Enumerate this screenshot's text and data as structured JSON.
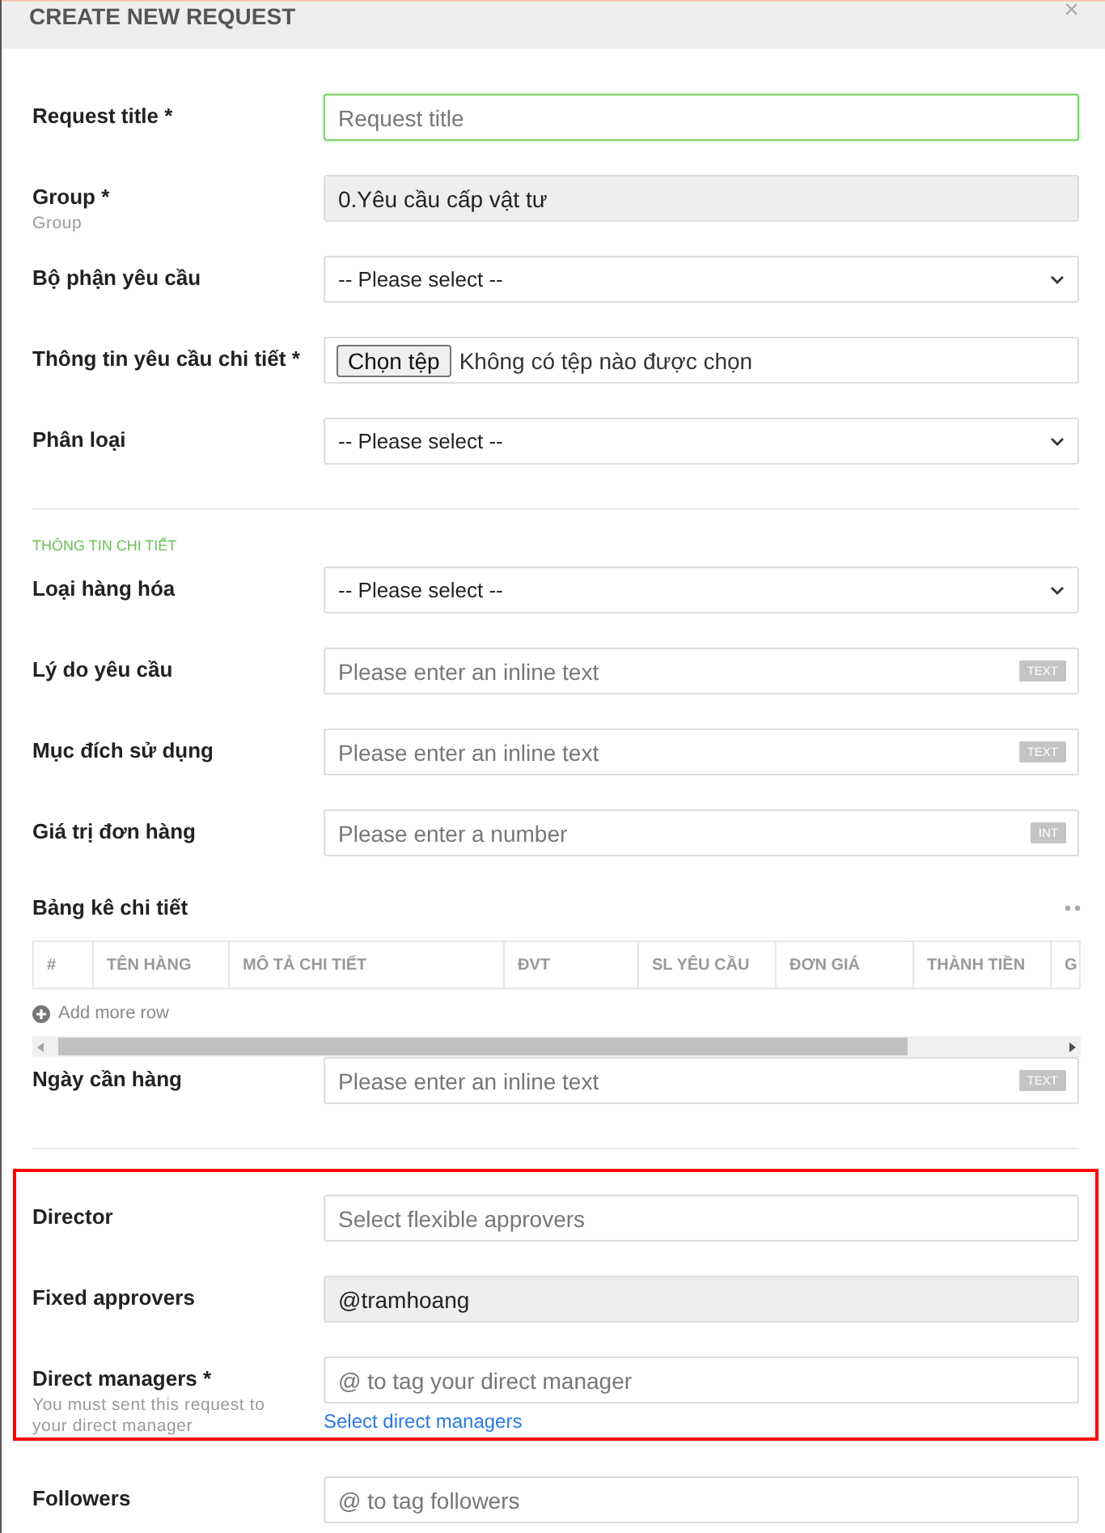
{
  "dialog": {
    "title": "CREATE NEW REQUEST",
    "close": "×"
  },
  "fields": [
    {
      "kind": "input",
      "label": "Request title *",
      "placeholder": "Request title",
      "focused": true
    },
    {
      "kind": "readonly",
      "label": "Group *",
      "hint": "Group",
      "value": "0.Yêu cầu cấp vật tư"
    },
    {
      "kind": "select",
      "label": "Bộ phận yêu cầu",
      "value": "-- Please select --"
    },
    {
      "kind": "file",
      "label": "Thông tin yêu cầu chi tiết *",
      "button": "Chọn tệp",
      "value": "Không có tệp nào được chọn"
    },
    {
      "kind": "select",
      "label": "Phân loại",
      "value": "-- Please select --"
    },
    {
      "kind": "divider"
    },
    {
      "kind": "section",
      "label": "THÔNG TIN CHI TIẾT"
    },
    {
      "kind": "select",
      "label": "Loại hàng hóa",
      "value": "-- Please select --"
    },
    {
      "kind": "input",
      "label": "Lý do yêu cầu",
      "placeholder": "Please enter an inline text",
      "badge": "TEXT",
      "focused": false
    },
    {
      "kind": "input",
      "label": "Mục đích sử dụng",
      "placeholder": "Please enter an inline text",
      "badge": "TEXT",
      "focused": false
    },
    {
      "kind": "input",
      "label": "Giá trị đơn hàng",
      "placeholder": "Please enter a number",
      "badge": "INT",
      "focused": false
    },
    {
      "kind": "table",
      "label": "Bảng kê chi tiết",
      "columns": [
        "#",
        "TÊN HÀNG",
        "MÔ TẢ CHI TIẾT",
        "ĐVT",
        "SL YÊU CẦU",
        "ĐƠN GIÁ",
        "THÀNH TIỀN",
        "G"
      ],
      "add_row": "Add more row"
    },
    {
      "kind": "input",
      "label": "Ngày cần hàng",
      "placeholder": "Please enter an inline text",
      "badge": "TEXT",
      "focused": false
    },
    {
      "kind": "divider"
    }
  ],
  "approvals": {
    "highlighted": true,
    "fields": [
      {
        "kind": "input",
        "label": "Director",
        "placeholder": "Select flexible approvers",
        "focused": false
      },
      {
        "kind": "readonly",
        "label": "Fixed approvers",
        "value": "@tramhoang"
      },
      {
        "kind": "input",
        "label": "Direct managers *",
        "hint": "You must sent this request to your direct manager",
        "placeholder": "@ to tag your direct manager",
        "link": "Select direct managers",
        "focused": false
      }
    ]
  },
  "after": [
    {
      "kind": "input",
      "label": "Followers",
      "placeholder": "@ to tag followers",
      "focused": false
    }
  ]
}
